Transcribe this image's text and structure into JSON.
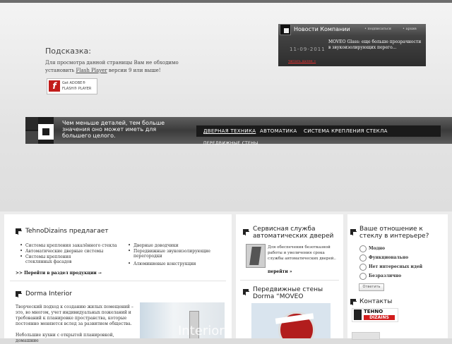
{
  "hint": {
    "title": "Подсказка:",
    "text_before": "Для просмотра данной страницы Вам не обходимо установить",
    "link": "Flash Player",
    "text_after": "версии 9 или выше!",
    "badge_line1": "Get ADOBE®",
    "badge_line2": "FLASH® PLAYER",
    "badge_icon": "f"
  },
  "news": {
    "title": "Новости Компании",
    "subscribe": "• подписаться",
    "archive": "• архив",
    "date": "11-09-2011",
    "item": "MOVEO Glass: еще больше прозрачности в звукоизолирующих перего...",
    "more": "читать далее »"
  },
  "band": {
    "slogan": "Чем меньше деталей, тем больше значения оно может иметь для большего целого.",
    "menu": [
      "ДВЕРНАЯ ТЕХНИКА",
      "АВТОМАТИКА",
      "СИСТЕМА КРЕПЛЕНИЯ СТЕКЛА"
    ],
    "menu_extra": "ПЕРЕДВИЖНЫЕ СТЕНЫ"
  },
  "offer": {
    "title": "TehnoDizains предлагает",
    "left_items": [
      "Системы крепления закалённого стекла",
      "Автоматические дверные системы",
      "Системы крепления стеклянных фасадов"
    ],
    "right_items": [
      "Дверные доводчики",
      "Передвижные звукоизолирующие перегородки",
      "Алюминиевые конструкции"
    ],
    "link": ">> Перейти в раздел продукции →"
  },
  "dorma": {
    "title": "Dorma Interior",
    "text": "Творческий подход к созданию жилых помещений – это, во многом, учет индивидуальных пожеланий и требований к планировке пространства, которые постоянно меняются вслед за развитием общества.",
    "text2": "Небольшие кухни с открытой планировкой, домашние",
    "photo_word": "Interior"
  },
  "service": {
    "title": "Сервисная служба автоматических дверей",
    "text": "Для обеспечения безотказной работы и увеличения срока службы автоматических дверей..",
    "link": "перейти »"
  },
  "walls": {
    "title": "Передвижные стены Dorma “MOVEO"
  },
  "poll": {
    "title": "Ваше отношение к стеклу в интерьере?",
    "options": [
      "Модно",
      "Функционально",
      "Нет интересных идей",
      "Безразлично"
    ],
    "button": "Ответить"
  },
  "contacts": {
    "title": "Контакты",
    "logo_top": "TEHNO",
    "logo_bottom": "DIZAINS"
  },
  "icons": [
    "flash-player-logo",
    "news-square-icon",
    "site-logo-squares",
    "section-square-icon"
  ]
}
